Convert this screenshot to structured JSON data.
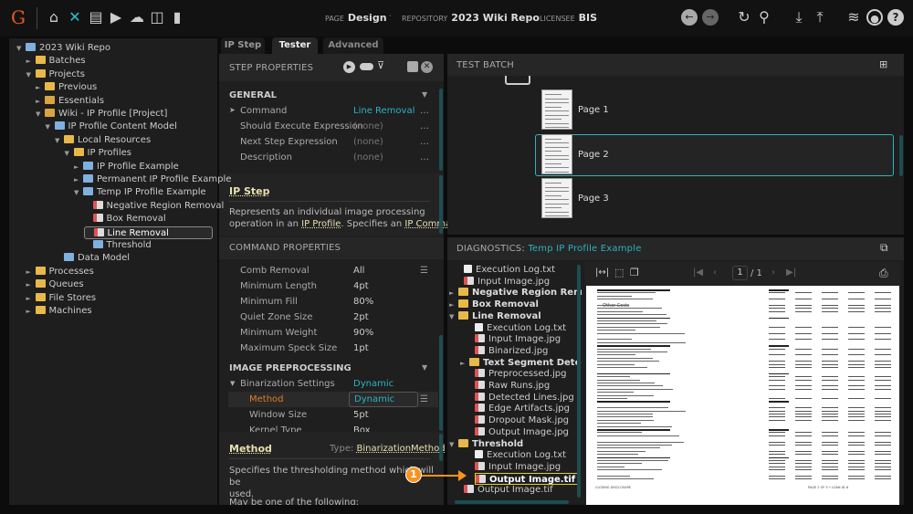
{
  "topbar": {
    "page_label": "PAGE",
    "page": "Design",
    "repo_label": "REPOSITORY",
    "repo": "2023 Wiki Repo",
    "licensee_label": "LICENSEE",
    "licensee": "BIS",
    "icons": [
      "home-icon",
      "tools-icon",
      "archive-icon",
      "media-icon",
      "cloud-upload-icon",
      "briefcase-clock-icon",
      "bar-chart-icon"
    ],
    "right_icons": [
      "back-icon",
      "forward-icon",
      "refresh-icon",
      "search-icon",
      "download-icon",
      "upload-icon",
      "database-icon",
      "user-icon",
      "help-icon"
    ]
  },
  "tree": [
    {
      "label": "2023 Wiki Repo",
      "depth": 0,
      "icon": "blue",
      "tw": "▼"
    },
    {
      "label": "Batches",
      "depth": 1,
      "icon": "folder",
      "tw": "►"
    },
    {
      "label": "Projects",
      "depth": 1,
      "icon": "folder",
      "tw": "▼"
    },
    {
      "label": "Previous",
      "depth": 2,
      "icon": "folder",
      "tw": "►"
    },
    {
      "label": "Essentials",
      "depth": 2,
      "icon": "cube",
      "tw": "►"
    },
    {
      "label": "Wiki - IP Profile [Project]",
      "depth": 2,
      "icon": "cube",
      "tw": "▼"
    },
    {
      "label": "IP Profile Content Model",
      "depth": 3,
      "icon": "blue",
      "tw": "▼"
    },
    {
      "label": "Local Resources",
      "depth": 4,
      "icon": "folder",
      "tw": "▼"
    },
    {
      "label": "IP Profiles",
      "depth": 5,
      "icon": "folder",
      "tw": "▼"
    },
    {
      "label": "IP Profile Example",
      "depth": 6,
      "icon": "blue",
      "tw": "►"
    },
    {
      "label": "Permanent IP Profile Example",
      "depth": 6,
      "icon": "blue",
      "tw": "►"
    },
    {
      "label": "Temp IP Profile Example",
      "depth": 6,
      "icon": "blue",
      "tw": "▼"
    },
    {
      "label": "Negative Region Removal",
      "depth": 7,
      "icon": "img",
      "tw": ""
    },
    {
      "label": "Box Removal",
      "depth": 7,
      "icon": "img",
      "tw": ""
    },
    {
      "label": "Line Removal",
      "depth": 7,
      "icon": "img",
      "tw": "",
      "selected": true
    },
    {
      "label": "Threshold",
      "depth": 7,
      "icon": "blue",
      "tw": ""
    },
    {
      "label": "Data Model",
      "depth": 4,
      "icon": "blue",
      "tw": ""
    },
    {
      "label": "Processes",
      "depth": 1,
      "icon": "folder",
      "tw": "►"
    },
    {
      "label": "Queues",
      "depth": 1,
      "icon": "folder",
      "tw": "►"
    },
    {
      "label": "File Stores",
      "depth": 1,
      "icon": "folder",
      "tw": "►"
    },
    {
      "label": "Machines",
      "depth": 1,
      "icon": "folder",
      "tw": "►"
    }
  ],
  "tabs": [
    "IP Step",
    "Tester",
    "Advanced"
  ],
  "step_properties": {
    "title": "STEP PROPERTIES",
    "general": "GENERAL",
    "rows": [
      {
        "name": "Command",
        "value": "Line Removal"
      },
      {
        "name": "Should Execute Expression",
        "value": "(none)"
      },
      {
        "name": "Next Step Expression",
        "value": "(none)"
      },
      {
        "name": "Description",
        "value": "(none)"
      }
    ],
    "help_title": "IP Step",
    "help_1": "Represents an individual image processing",
    "help_2": "operation in an ",
    "help_link1": "IP Profile",
    "help_3": ". Specifies an ",
    "help_link2": "IP Command"
  },
  "command_properties": {
    "title": "COMMAND PROPERTIES",
    "rows": [
      {
        "name": "Comb Removal",
        "value": "All"
      },
      {
        "name": "Minimum Length",
        "value": "4pt"
      },
      {
        "name": "Minimum Fill",
        "value": "80%"
      },
      {
        "name": "Quiet Zone Size",
        "value": "2pt"
      },
      {
        "name": "Minimum Weight",
        "value": "90%"
      },
      {
        "name": "Maximum Speck Size",
        "value": "1pt"
      }
    ],
    "preprocessing": "IMAGE PREPROCESSING",
    "binarization": "Binarization Settings",
    "binarization_value": "Dynamic",
    "method": "Method",
    "method_value": "Dynamic",
    "window": "Window Size",
    "window_value": "5pt",
    "kernel": "Kernel Type",
    "kernel_value": "Box",
    "help_title": "Method",
    "help_type_label": "Type:",
    "help_type": "BinarizationMethod",
    "help_1": "Specifies the thresholding method which will be",
    "help_2": "used.",
    "help_3": "May be one of the following:"
  },
  "test_batch": {
    "title": "TEST BATCH",
    "pages": [
      "Page 1",
      "Page 2",
      "Page 3"
    ],
    "selected": "Page 2"
  },
  "diagnostics": {
    "title": "DIAGNOSTICS:",
    "profile": "Temp IP Profile Example",
    "files": [
      {
        "label": "Execution Log.txt",
        "depth": 1,
        "icon": "txt"
      },
      {
        "label": "Input Image.jpg",
        "depth": 1,
        "icon": "img"
      },
      {
        "label": "Negative Region Removal",
        "depth": 0,
        "icon": "folder",
        "tw": "►",
        "bold": true
      },
      {
        "label": "Box Removal",
        "depth": 0,
        "icon": "folder",
        "tw": "►",
        "bold": true
      },
      {
        "label": "Line Removal",
        "depth": 0,
        "icon": "folder",
        "tw": "▼",
        "bold": true
      },
      {
        "label": "Execution Log.txt",
        "depth": 2,
        "icon": "txt"
      },
      {
        "label": "Input Image.jpg",
        "depth": 2,
        "icon": "img"
      },
      {
        "label": "Binarized.jpg",
        "depth": 2,
        "icon": "img"
      },
      {
        "label": "Text Segment Detection",
        "depth": 1,
        "icon": "folder",
        "tw": "►",
        "bold": true
      },
      {
        "label": "Preprocessed.jpg",
        "depth": 2,
        "icon": "img"
      },
      {
        "label": "Raw Runs.jpg",
        "depth": 2,
        "icon": "img"
      },
      {
        "label": "Detected Lines.jpg",
        "depth": 2,
        "icon": "img"
      },
      {
        "label": "Edge Artifacts.jpg",
        "depth": 2,
        "icon": "img"
      },
      {
        "label": "Dropout Mask.jpg",
        "depth": 2,
        "icon": "img"
      },
      {
        "label": "Output Image.jpg",
        "depth": 2,
        "icon": "img"
      },
      {
        "label": "Threshold",
        "depth": 0,
        "icon": "folder",
        "tw": "▼",
        "bold": true
      },
      {
        "label": "Execution Log.txt",
        "depth": 2,
        "icon": "txt"
      },
      {
        "label": "Input Image.jpg",
        "depth": 2,
        "icon": "img"
      },
      {
        "label": "Output Image.tif",
        "depth": 2,
        "icon": "img",
        "highlight": true
      },
      {
        "label": "Output Image.tif",
        "depth": 1,
        "icon": "img"
      }
    ]
  },
  "viewer": {
    "page_value": "1",
    "page_total": "/ 1",
    "doc_other_costs": "Other Costs",
    "doc_footer_left": "CLOSING DISCLOSURE",
    "doc_footer_right": "PAGE 2 OF 5 • LOAN ID #"
  },
  "callout": {
    "number": "1",
    "color": "#f7931e"
  },
  "colors": {
    "accent": "#2bb3c0",
    "highlight": "#e0d020",
    "method": "#e07b20"
  }
}
